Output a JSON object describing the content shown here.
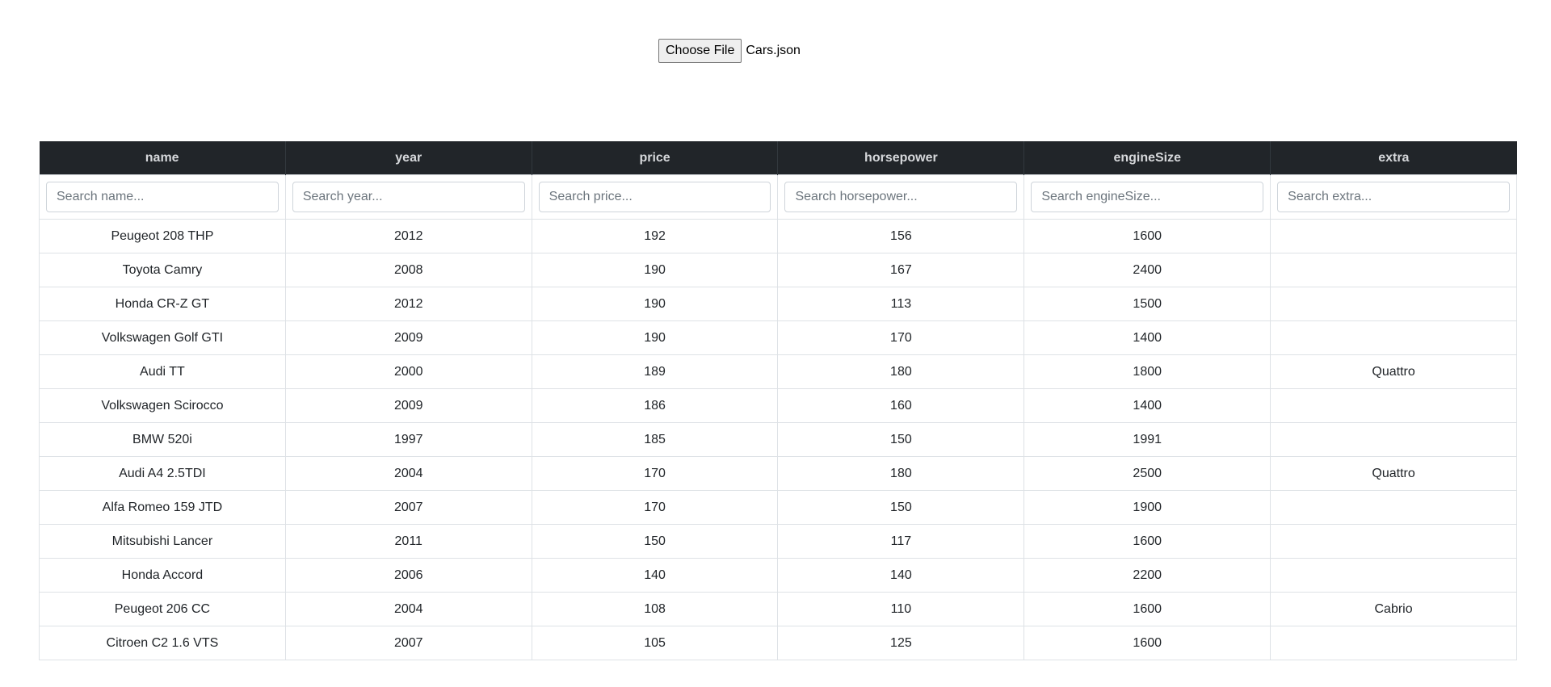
{
  "upload": {
    "button_label": "Choose File",
    "file_name": "Cars.json"
  },
  "table": {
    "columns": [
      {
        "key": "name",
        "label": "name",
        "placeholder": "Search name..."
      },
      {
        "key": "year",
        "label": "year",
        "placeholder": "Search year..."
      },
      {
        "key": "price",
        "label": "price",
        "placeholder": "Search price..."
      },
      {
        "key": "horsepower",
        "label": "horsepower",
        "placeholder": "Search horsepower..."
      },
      {
        "key": "engineSize",
        "label": "engineSize",
        "placeholder": "Search engineSize..."
      },
      {
        "key": "extra",
        "label": "extra",
        "placeholder": "Search extra..."
      }
    ],
    "rows": [
      [
        "Peugeot 208 THP",
        "2012",
        "192",
        "156",
        "1600",
        ""
      ],
      [
        "Toyota Camry",
        "2008",
        "190",
        "167",
        "2400",
        ""
      ],
      [
        "Honda CR-Z GT",
        "2012",
        "190",
        "113",
        "1500",
        ""
      ],
      [
        "Volkswagen Golf GTI",
        "2009",
        "190",
        "170",
        "1400",
        ""
      ],
      [
        "Audi TT",
        "2000",
        "189",
        "180",
        "1800",
        "Quattro"
      ],
      [
        "Volkswagen Scirocco",
        "2009",
        "186",
        "160",
        "1400",
        ""
      ],
      [
        "BMW 520i",
        "1997",
        "185",
        "150",
        "1991",
        ""
      ],
      [
        "Audi A4 2.5TDI",
        "2004",
        "170",
        "180",
        "2500",
        "Quattro"
      ],
      [
        "Alfa Romeo 159 JTD",
        "2007",
        "170",
        "150",
        "1900",
        ""
      ],
      [
        "Mitsubishi Lancer",
        "2011",
        "150",
        "117",
        "1600",
        ""
      ],
      [
        "Honda Accord",
        "2006",
        "140",
        "140",
        "2200",
        ""
      ],
      [
        "Peugeot 206 CC",
        "2004",
        "108",
        "110",
        "1600",
        "Cabrio"
      ],
      [
        "Citroen C2 1.6 VTS",
        "2007",
        "105",
        "125",
        "1600",
        ""
      ]
    ]
  }
}
